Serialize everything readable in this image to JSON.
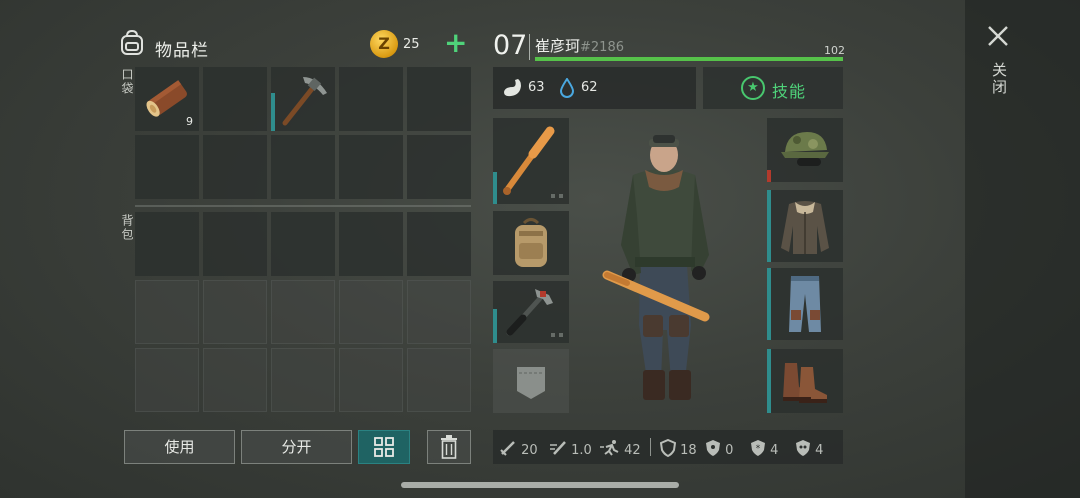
{
  "inventory": {
    "title": "物品栏",
    "coins": "25",
    "add_icon": "plus-icon",
    "pocket_label": "口袋",
    "backpack_label": "背包",
    "pocket_items": [
      {
        "icon": "wood-log-icon",
        "quantity": "9"
      },
      {
        "icon": null
      },
      {
        "icon": "pickaxe-icon",
        "quantity": null,
        "durability": 0.6
      },
      {
        "icon": null
      },
      {
        "icon": null
      }
    ]
  },
  "actions": {
    "use_label": "使用",
    "split_label": "分开",
    "grid_view_icon": "grid-view-icon",
    "trash_icon": "trash-icon"
  },
  "character": {
    "level": "07",
    "name": "崔彦珂",
    "id": "#2186",
    "hp": "102",
    "hp_fraction": 1.0,
    "hunger": "63",
    "thirst": "62",
    "skills_label": "技能"
  },
  "equipment": {
    "left_slots": [
      "baseball-bat-icon",
      "backpack-icon",
      "hammer-icon",
      "pocket-icon"
    ],
    "right_slots": [
      "camo-cap-icon",
      "bomber-jacket-icon",
      "cargo-pants-icon",
      "boots-icon"
    ]
  },
  "stats": [
    {
      "icon": "damage-icon",
      "value": "20"
    },
    {
      "icon": "attack-speed-icon",
      "value": "1.0"
    },
    {
      "icon": "run-speed-icon",
      "value": "42"
    },
    {
      "icon": "armor-icon",
      "value": "18"
    },
    {
      "icon": "radiation-icon",
      "value": "0"
    },
    {
      "icon": "cold-resist-icon",
      "value": "4"
    },
    {
      "icon": "toxic-icon",
      "value": "4"
    }
  ],
  "close_label": "关闭",
  "colors": {
    "accent_green": "#4fd37a",
    "teal": "#2f8d8d",
    "hp_green": "#56c24a"
  }
}
